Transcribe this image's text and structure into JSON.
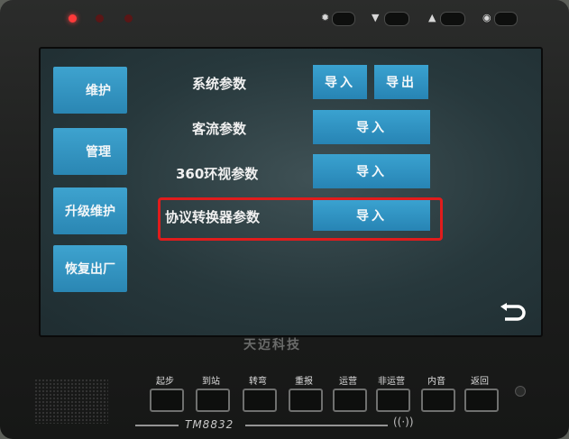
{
  "side_menu": {
    "items": [
      {
        "label": "维护"
      },
      {
        "label": "管理"
      },
      {
        "label": "升级维护"
      },
      {
        "label": "恢复出厂"
      }
    ]
  },
  "params": {
    "system": {
      "label": "系统参数",
      "import": "导入",
      "export": "导出"
    },
    "passenger": {
      "label": "客流参数",
      "import": "导入"
    },
    "surround": {
      "label": "360环视参数",
      "import": "导入"
    },
    "protocol": {
      "label": "协议转换器参数",
      "import": "导入"
    }
  },
  "brand": "天迈科技",
  "model": "TM8832",
  "keypad": {
    "labels": [
      "起步",
      "到站",
      "转弯",
      "重报",
      "运营",
      "非运营",
      "内音",
      "返回"
    ]
  },
  "colors": {
    "highlight": "#e01c1c",
    "button_blue": "#2f93c2"
  }
}
